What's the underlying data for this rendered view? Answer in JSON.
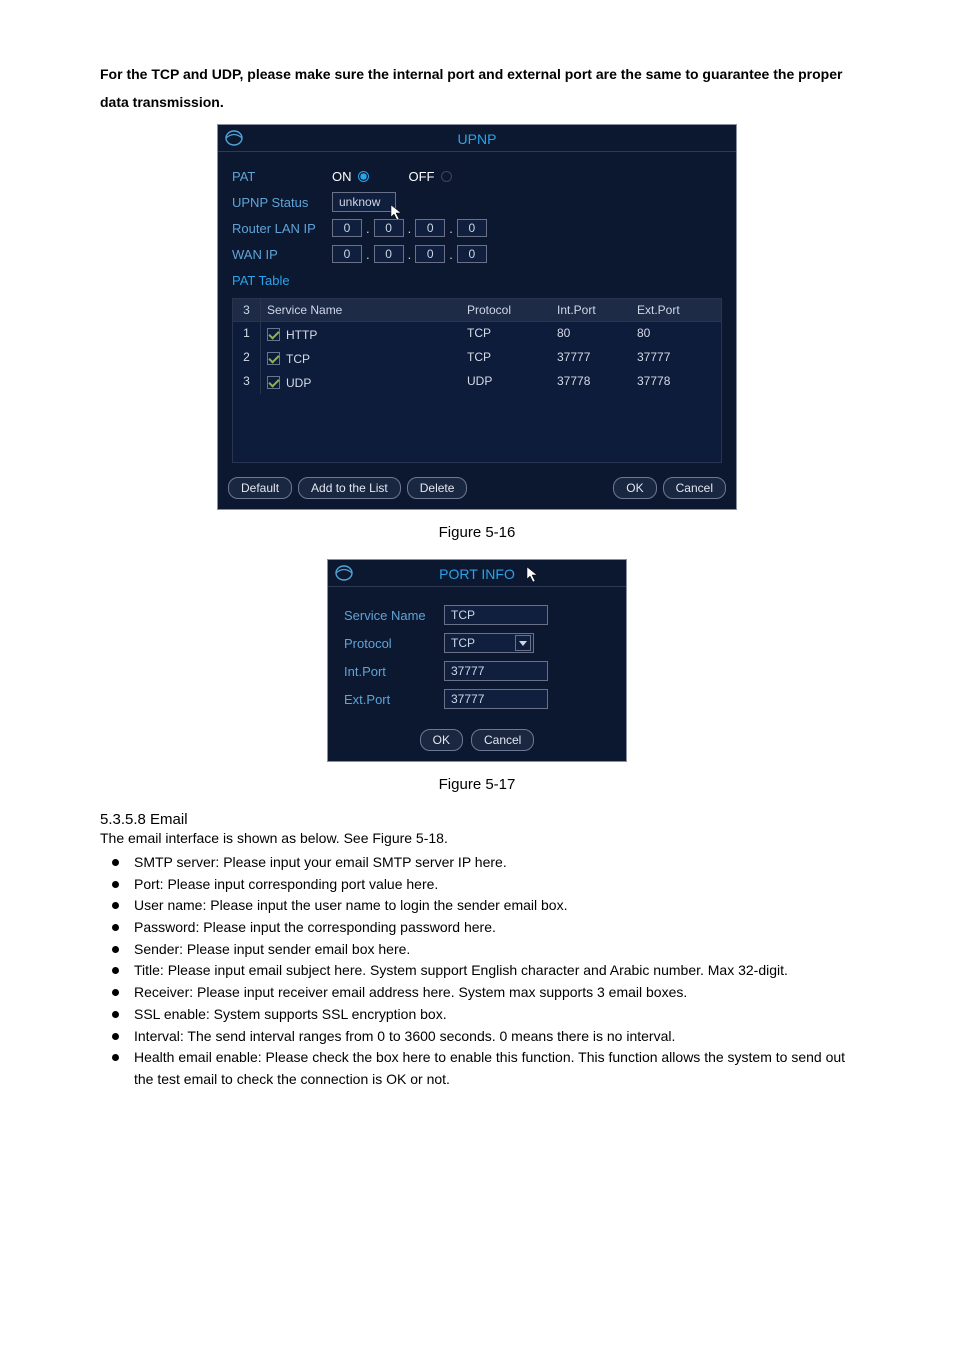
{
  "intro": "For the TCP and UDP, please make sure the internal port and external port are the same to guarantee the proper data transmission.",
  "upnp": {
    "title": "UPNP",
    "pat_label": "PAT",
    "on_label": "ON",
    "off_label": "OFF",
    "upnp_status_label": "UPNP Status",
    "upnp_status_value": "unknow",
    "router_lan_label": "Router LAN IP",
    "wan_ip_label": "WAN IP",
    "router_ip": [
      "0",
      "0",
      "0",
      "0"
    ],
    "wan_ip": [
      "0",
      "0",
      "0",
      "0"
    ],
    "pat_table_label": "PAT Table",
    "table": {
      "count": "3",
      "cols": {
        "service": "Service Name",
        "protocol": "Protocol",
        "intport": "Int.Port",
        "extport": "Ext.Port"
      },
      "rows": [
        {
          "n": "1",
          "svc": "HTTP",
          "proto": "TCP",
          "ip": "80",
          "ep": "80"
        },
        {
          "n": "2",
          "svc": "TCP",
          "proto": "TCP",
          "ip": "37777",
          "ep": "37777"
        },
        {
          "n": "3",
          "svc": "UDP",
          "proto": "UDP",
          "ip": "37778",
          "ep": "37778"
        }
      ]
    },
    "buttons": {
      "default_": "Default",
      "add": "Add to the List",
      "delete_": "Delete",
      "ok": "OK",
      "cancel": "Cancel"
    }
  },
  "fig1": "Figure 5-16",
  "portinfo": {
    "title": "PORT INFO",
    "service_label": "Service Name",
    "service_value": "TCP",
    "protocol_label": "Protocol",
    "protocol_value": "TCP",
    "intport_label": "Int.Port",
    "intport_value": "37777",
    "extport_label": "Ext.Port",
    "extport_value": "37777",
    "ok": "OK",
    "cancel": "Cancel"
  },
  "fig2": "Figure 5-17",
  "email": {
    "heading": "5.3.5.8  Email",
    "desc": "The email interface is shown as below. See Figure 5-18.",
    "items": [
      "SMTP server: Please input your email SMTP server IP here.",
      "Port: Please input corresponding port value here.",
      "User name:  Please input the user name to login the sender email box.",
      "Password: Please input the corresponding password here.",
      "Sender: Please input sender email box here.",
      "Title: Please input email subject here. System support English character and Arabic number. Max 32-digit.",
      "Receiver: Please input receiver email address here. System max supports 3 email boxes.",
      "SSL enable: System supports SSL encryption box.",
      "Interval: The send interval ranges from 0 to 3600 seconds. 0 means there is no interval.",
      "Health email enable: Please check the box here to enable this function. This function allows the system to send out the test email to check the connection is OK or not."
    ]
  }
}
